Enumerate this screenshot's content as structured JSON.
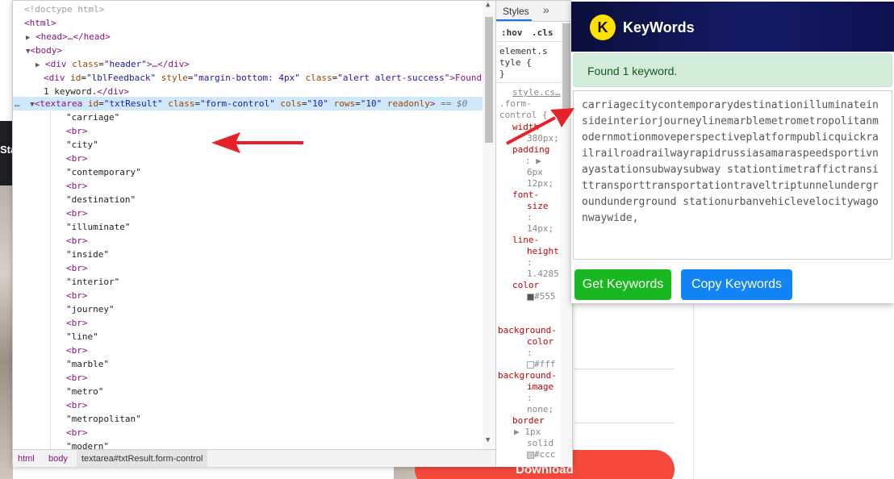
{
  "background": {
    "left_text": "Sta",
    "download_label": "Download"
  },
  "devtools": {
    "lines": {
      "doctype": "<!doctype html>",
      "html_open": "<html>",
      "head": "<head>…</head>",
      "body_open": "<body>",
      "div_header_tag": "<div",
      "div_header_attr": "class",
      "div_header_val": "\"header\"",
      "div_header_end": ">…</div>",
      "div_fb_tag": "<div",
      "div_fb_attr1": "id",
      "div_fb_val1": "\"lblFeedback\"",
      "div_fb_attr2": "style",
      "div_fb_val2": "\"margin-bottom: 4px\"",
      "div_fb_attr3": "class",
      "div_fb_val3": "\"alert alert-success\"",
      "div_fb_text": ">Found",
      "div_fb_cont": "1 keyword.",
      "div_fb_close": "</div>",
      "ta_tag": "<textarea",
      "ta_attr1": "id",
      "ta_val1": "\"txtResult\"",
      "ta_attr2": "class",
      "ta_val2": "\"form-control\"",
      "ta_attr3": "cols",
      "ta_val3": "\"10\"",
      "ta_attr4": "rows",
      "ta_val4": "\"10\"",
      "ta_attr5": "readonly",
      "ta_end": ">",
      "ta_eq": "== $0",
      "dots": "…"
    },
    "textarea_children": [
      "\"carriage\"",
      "<br>",
      "\"city\"",
      "<br>",
      "\"contemporary\"",
      "<br>",
      "\"destination\"",
      "<br>",
      "\"illuminate\"",
      "<br>",
      "\"inside\"",
      "<br>",
      "\"interior\"",
      "<br>",
      "\"journey\"",
      "<br>",
      "\"line\"",
      "<br>",
      "\"marble\"",
      "<br>",
      "\"metro\"",
      "<br>",
      "\"metropolitan\"",
      "<br>",
      "\"modern\""
    ],
    "breadcrumb": [
      "html",
      "body",
      "textarea#txtResult.form-control"
    ],
    "styles": {
      "tab": "Styles",
      "more": "»",
      "hov": ":hov",
      "cls": ".cls",
      "element_style_1": "element.s",
      "element_style_2": "tyle {",
      "element_style_3": "}",
      "source": "style.cs…",
      "selector_1": ".form-",
      "selector_2": "control {",
      "width_prop": "width",
      "width_val": "380px;",
      "padding_prop": "padding",
      "padding_val_1": "6px",
      "padding_val_2": "12px;",
      "font_prop_1": "font-",
      "font_prop_2": "size",
      "font_val": "14px;",
      "lh_prop_1": "line-",
      "lh_prop_2": "height",
      "lh_val": "1.4285",
      "color_prop": "color",
      "color_val": "#555",
      "bgc_prop_1": "background-",
      "bgc_prop_2": "color",
      "bgc_val": "#fff",
      "bgi_prop_1": "background-",
      "bgi_prop_2": "image",
      "bgi_val": "none;",
      "border_prop": "border",
      "border_val_1": "1px",
      "border_val_2": "solid",
      "border_val_3": "#ccc",
      "colon": ":",
      "tri": "▶"
    }
  },
  "popup": {
    "logo_letter": "K",
    "title": "KeyWords",
    "alert": "Found 1 keyword.",
    "result": "carriagecitycontemporarydestinationilluminateinsideinteriorjourneylinemarblemetrometropolitanmodernmotionmoveperspectiveplatformpublicquickrailrailroadrailwayrapidrussiasamaraspeedsportivnayastationsubwaysubway stationtimetraffictransittransporttransportationtraveltriptunnelundergroundunderground stationurbanvehiclevelocitywagonwaywide,",
    "get_button": "Get Keywords",
    "copy_button": "Copy Keywords"
  },
  "colors": {
    "alert_bg": "#d4edda",
    "get_button": "#1ab820",
    "copy_button": "#1183f5",
    "header_dark": "#0b0f3a",
    "arrow": "#e8202a",
    "selection": "#cfe8fc"
  }
}
